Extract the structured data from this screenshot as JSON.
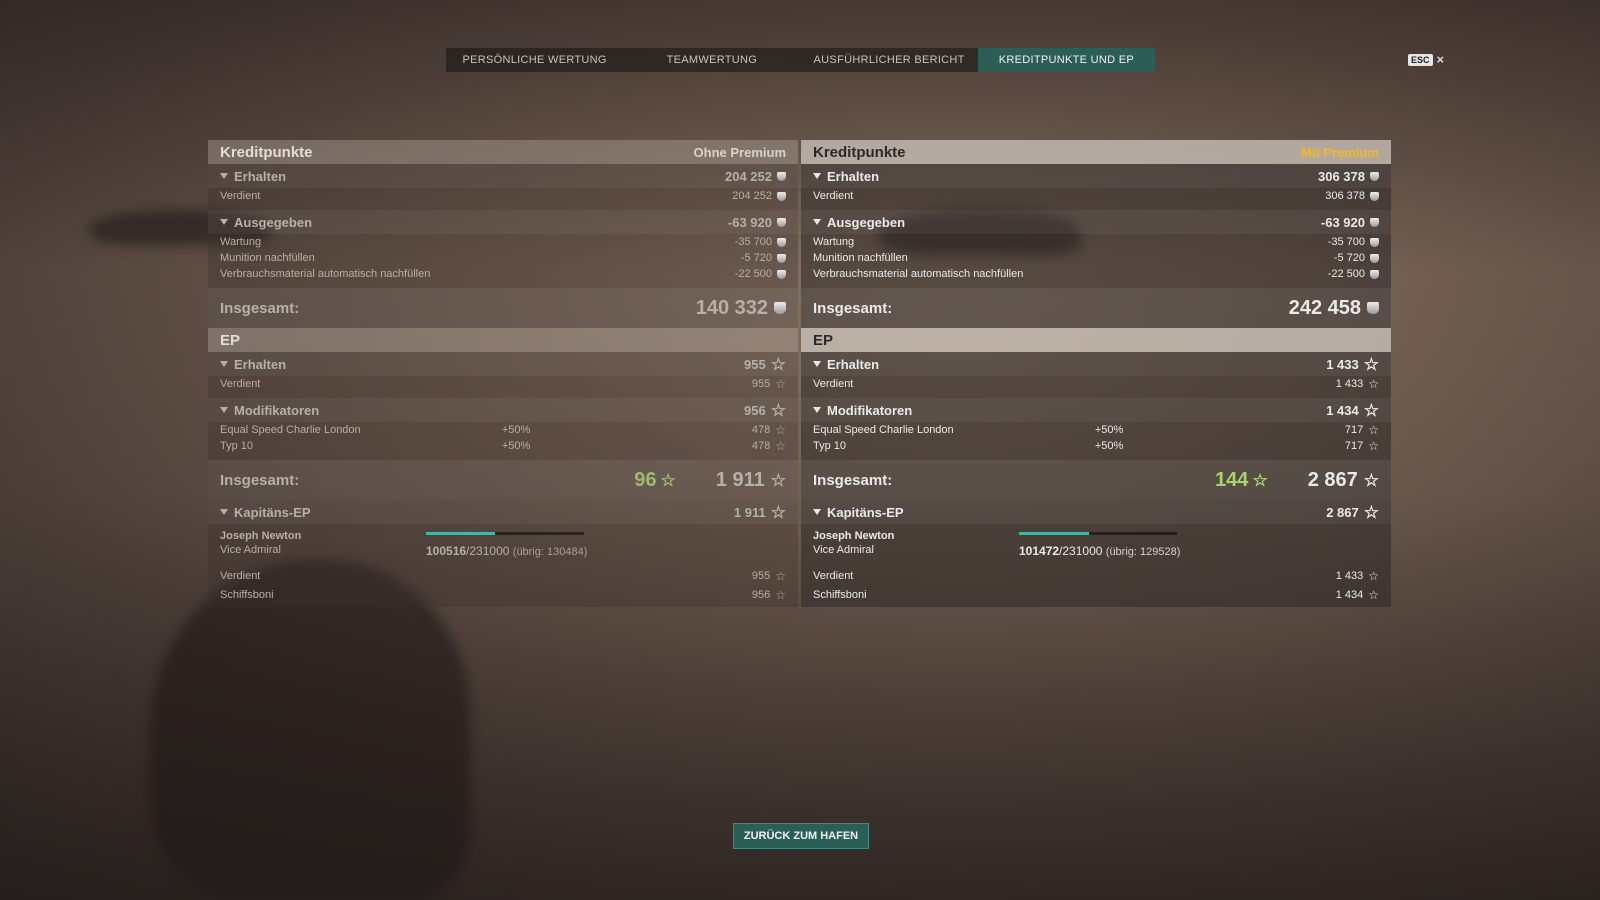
{
  "tabs": [
    {
      "label": "PERSÖNLICHE WERTUNG",
      "active": false
    },
    {
      "label": "TEAMWERTUNG",
      "active": false
    },
    {
      "label": "AUSFÜHRLICHER BERICHT",
      "active": false
    },
    {
      "label": "KREDITPUNKTE UND EP",
      "active": true
    }
  ],
  "esc": {
    "key": "ESC",
    "close": "×"
  },
  "left": {
    "credits_title": "Kreditpunkte",
    "credits_sub": "Ohne Premium",
    "erhalten": {
      "label": "Erhalten",
      "value": "204 252"
    },
    "verdient": {
      "label": "Verdient",
      "value": "204 252"
    },
    "ausgegeben": {
      "label": "Ausgegeben",
      "value": "-63 920"
    },
    "wartung": {
      "label": "Wartung",
      "value": "-35 700"
    },
    "munition": {
      "label": "Munition nachfüllen",
      "value": "-5 720"
    },
    "verbrauch": {
      "label": "Verbrauchsmaterial automatisch nachfüllen",
      "value": "-22 500"
    },
    "total_credits": {
      "label": "Insgesamt:",
      "value": "140 332"
    },
    "ep_title": "EP",
    "ep_erhalten": {
      "label": "Erhalten",
      "value": "955"
    },
    "ep_verdient": {
      "label": "Verdient",
      "value": "955"
    },
    "mods": {
      "label": "Modifikatoren",
      "value": "956"
    },
    "mod1": {
      "label": "Equal Speed Charlie London",
      "pct": "+50%",
      "value": "478"
    },
    "mod2": {
      "label": "Typ 10",
      "pct": "+50%",
      "value": "478"
    },
    "total_ep": {
      "label": "Insgesamt:",
      "bonus": "96",
      "value": "1 911"
    },
    "captain_ep": {
      "label": "Kapitäns-EP",
      "value": "1 911"
    },
    "captain": {
      "name": "Joseph Newton",
      "rank": "Vice Admiral",
      "xp": "100516",
      "max": "/231000",
      "rest": "(übrig: 130484)",
      "progress": 0.435
    },
    "cap_verdient": {
      "label": "Verdient",
      "value": "955"
    },
    "cap_schiff": {
      "label": "Schiffsboni",
      "value": "956"
    }
  },
  "right": {
    "credits_title": "Kreditpunkte",
    "credits_sub": "Mit Premium",
    "erhalten": {
      "label": "Erhalten",
      "value": "306 378"
    },
    "verdient": {
      "label": "Verdient",
      "value": "306 378"
    },
    "ausgegeben": {
      "label": "Ausgegeben",
      "value": "-63 920"
    },
    "wartung": {
      "label": "Wartung",
      "value": "-35 700"
    },
    "munition": {
      "label": "Munition nachfüllen",
      "value": "-5 720"
    },
    "verbrauch": {
      "label": "Verbrauchsmaterial automatisch nachfüllen",
      "value": "-22 500"
    },
    "total_credits": {
      "label": "Insgesamt:",
      "value": "242 458"
    },
    "ep_title": "EP",
    "ep_erhalten": {
      "label": "Erhalten",
      "value": "1 433"
    },
    "ep_verdient": {
      "label": "Verdient",
      "value": "1 433"
    },
    "mods": {
      "label": "Modifikatoren",
      "value": "1 434"
    },
    "mod1": {
      "label": "Equal Speed Charlie London",
      "pct": "+50%",
      "value": "717"
    },
    "mod2": {
      "label": "Typ 10",
      "pct": "+50%",
      "value": "717"
    },
    "total_ep": {
      "label": "Insgesamt:",
      "bonus": "144",
      "value": "2 867"
    },
    "captain_ep": {
      "label": "Kapitäns-EP",
      "value": "2 867"
    },
    "captain": {
      "name": "Joseph Newton",
      "rank": "Vice Admiral",
      "xp": "101472",
      "max": "/231000",
      "rest": "(übrig: 129528)",
      "progress": 0.44
    },
    "cap_verdient": {
      "label": "Verdient",
      "value": "1 433"
    },
    "cap_schiff": {
      "label": "Schiffsboni",
      "value": "1 434"
    }
  },
  "icons": {
    "star": "☆",
    "credit": "credit-coin-icon"
  },
  "back_button": "ZURÜCK ZUM HAFEN"
}
